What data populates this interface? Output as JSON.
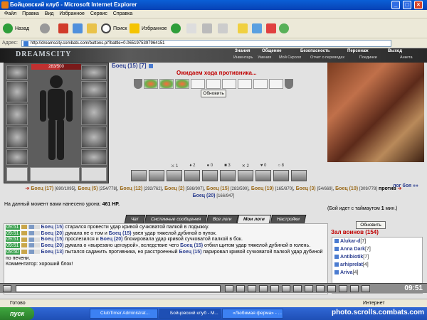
{
  "window": {
    "title": "Бойцовский клуб - Microsoft Internet Explorer"
  },
  "menu": [
    "Файл",
    "Правка",
    "Вид",
    "Избранное",
    "Сервис",
    "Справка"
  ],
  "toolbar": {
    "back": "Назад",
    "search": "Поиск",
    "favorites": "Избранное"
  },
  "address": {
    "label": "Адрес:",
    "url": "http://dreamscity.combats.com/buttons.pl?battle=0.0651975397964151"
  },
  "game_header": {
    "logo": "DREAMSCITY",
    "nav": [
      "Знания",
      "Общение",
      "Безопасность",
      "Персонаж",
      "Выход"
    ],
    "subnav": [
      "Инвентарь",
      "Умения",
      "Мой Скролл",
      "Отчет о переводах",
      "Поединки",
      "Анкета"
    ]
  },
  "player": {
    "name": "Боец",
    "level": "(15)",
    "slots": "[7]",
    "hp": "283/500",
    "hp_fraction": 0.566
  },
  "fight": {
    "waiting": "Ожидаем хода противника...",
    "refresh": "Обновить"
  },
  "counters": [
    "1",
    "2",
    "0",
    "3",
    "2",
    "0",
    "8"
  ],
  "logs_link": "лог боя »»",
  "team1": [
    {
      "name": "Боец (17)",
      "hp": "[690/1095]"
    },
    {
      "name": "Боец (5)",
      "hp": "[254/778]"
    },
    {
      "name": "Боец (12)",
      "hp": "[292/762]"
    },
    {
      "name": "Боец (2)",
      "hp": "[586/907]"
    },
    {
      "name": "Боец (15)",
      "hp": "[283/590]"
    },
    {
      "name": "Боец (19)",
      "hp": "[165/870]"
    },
    {
      "name": "Боец (3)",
      "hp": "[54/669]"
    },
    {
      "name": "Боец (10)",
      "hp": "[309/778]"
    }
  ],
  "vs": "против",
  "team2": [
    {
      "name": "Боец (20)",
      "hp": "[166/947]"
    }
  ],
  "damage": {
    "text": "На данный момент вами нанесено урона:",
    "value": "461 HP."
  },
  "timeout": {
    "text": "(Бой идет с таймаутом",
    "value": "1",
    "unit": "мин.)"
  },
  "tabs": [
    "Чат",
    "Системные сообщения",
    "Все логи",
    "Мои логи",
    "Настройки"
  ],
  "active_tab": "Мои логи",
  "chat": [
    {
      "time": "09:51",
      "p1": "Боец (15)",
      "text": "старался провести удар кривой сучковатой палкой в лодыжку.",
      "p2": "",
      "text2": ""
    },
    {
      "time": "09:51",
      "p1": "Боец (20)",
      "text": "думала не о том и",
      "p2": "Боец (15)",
      "text2": "увел удар тяжелой дубиной в пупок."
    },
    {
      "time": "09:51",
      "p1": "Боец (15)",
      "text": "прослезился и",
      "p2": "Боец (20)",
      "text2": "блокировала удар кривой сучковатой палкой в бок."
    },
    {
      "time": "09:51",
      "p1": "Боец (20)",
      "text": "думала о «вырезано цензурой», вследствие чего",
      "p2": "Боец (15)",
      "text2": "отбил щитом удар тяжелой дубиной в голень."
    },
    {
      "time": "09:50",
      "p1": "Боец (13)",
      "text": "пытался саданить противника, но расстроенный",
      "p2": "Боец (15)",
      "text2": "парировал кривой сучковатой палкой удар дубиной по печени."
    },
    {
      "time": "",
      "p1": "",
      "text": "Комментатор: хороший блок!",
      "p2": "",
      "text2": ""
    }
  ],
  "room": {
    "refresh": "Обновить",
    "title": "Зал воинов (154)",
    "players": [
      {
        "name": "Alukar-d",
        "lvl": "[7]"
      },
      {
        "name": "Anna Dark",
        "lvl": "[7]"
      },
      {
        "name": "Antibiotik",
        "lvl": "[7]"
      },
      {
        "name": "arhiprelat",
        "lvl": "[4]"
      },
      {
        "name": "Ariva",
        "lvl": "[4]"
      }
    ]
  },
  "clock": "09:51",
  "status": {
    "left": "Готово",
    "right": "Интернет"
  },
  "taskbar": {
    "start": "пуск",
    "tasks": [
      "ClubTimer Administrat...",
      "Бойцовский клуб - M...",
      "«Любимая ферма» - ..."
    ],
    "watermark": "photo.scrolls.combats.com"
  }
}
